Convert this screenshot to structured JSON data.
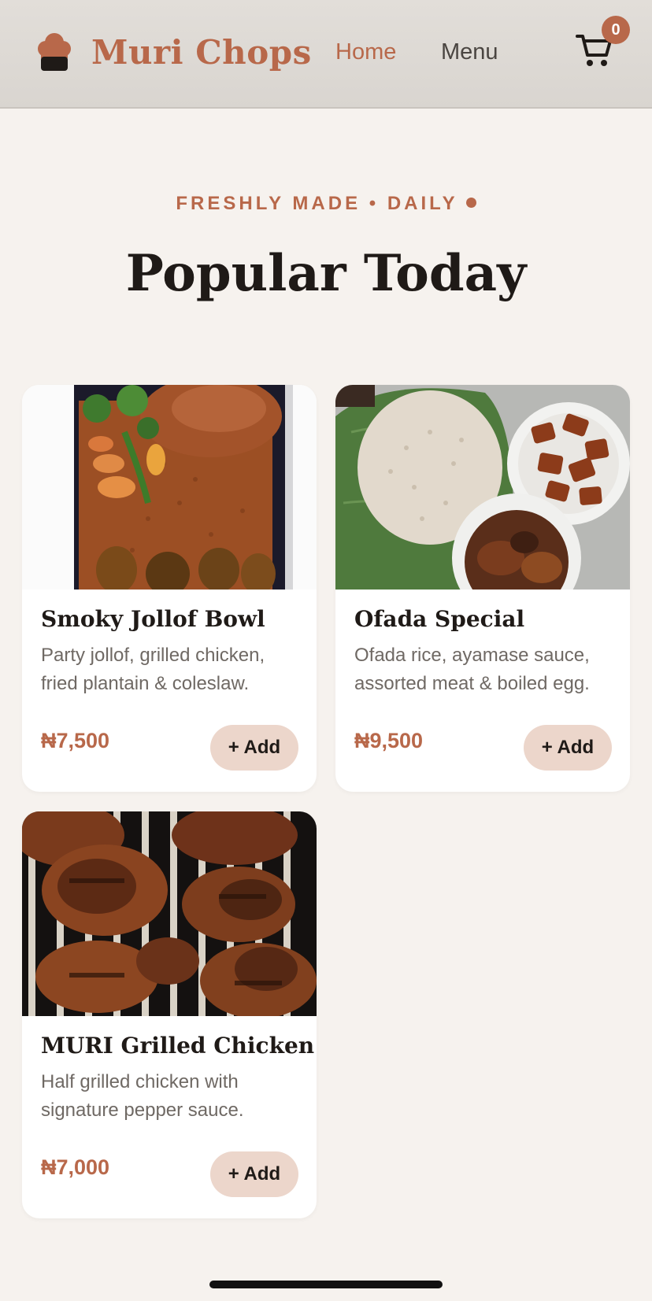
{
  "header": {
    "brand": "Muri Chops",
    "nav": {
      "home": "Home",
      "menu": "Menu"
    },
    "cart_count": "0"
  },
  "section": {
    "eyebrow": "FRESHLY MADE • DAILY",
    "title": "Popular Today"
  },
  "items": [
    {
      "name": "Smoky Jollof Bowl",
      "description": "Party jollof, grilled chicken, fried plantain & coleslaw.",
      "price": "₦7,500",
      "add_label": "+ Add",
      "image": "jollof-rice-bowl-photo"
    },
    {
      "name": "Ofada Special",
      "description": "Ofada rice, ayamase sauce, assorted meat & boiled egg.",
      "price": "₦9,500",
      "add_label": "+ Add",
      "image": "ofada-rice-platter-photo"
    },
    {
      "name": "MURI Grilled Chicken",
      "description": "Half grilled chicken with signature pepper sauce.",
      "price": "₦7,000",
      "add_label": "+ Add",
      "image": "grilled-chicken-photo"
    }
  ],
  "colors": {
    "accent": "#b8684a",
    "background": "#f6f2ee",
    "header_bg": "#dcd8d3",
    "button_bg": "#ecd6cb",
    "text_dark": "#1f1a17",
    "text_muted": "#6f6964"
  },
  "icons": {
    "logo": "chef-hat-icon",
    "cart": "shopping-cart-icon"
  }
}
